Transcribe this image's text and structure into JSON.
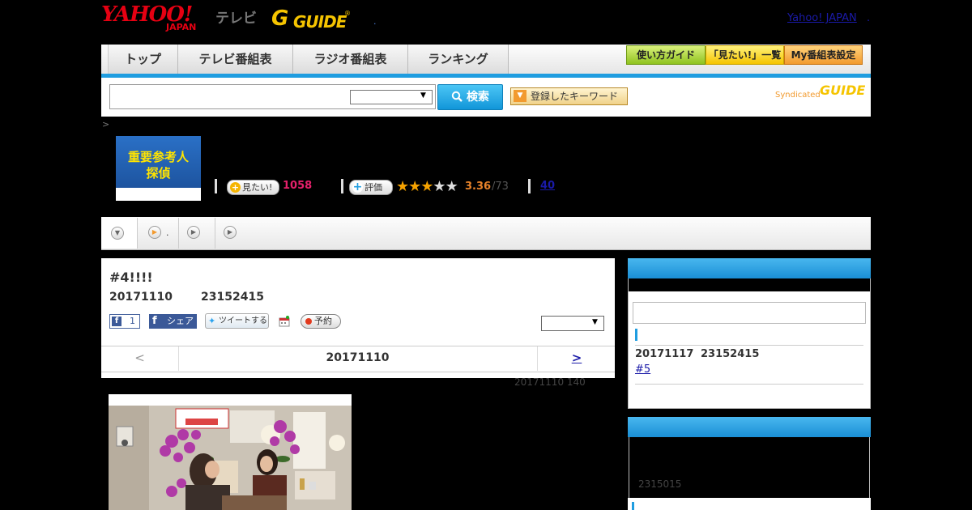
{
  "header": {
    "logo_yahoo": "YAHOO!",
    "logo_japan": "JAPAN",
    "logo_tv": "テレビ",
    "logo_gguide": "GUIDE",
    "logo_g": "G",
    "registered": "®",
    "dot": ".",
    "yahoo_japan_link": "Yahoo! JAPAN",
    "yj_dot": "."
  },
  "nav": {
    "tabs": [
      {
        "label": "トップ"
      },
      {
        "label": "テレビ番組表"
      },
      {
        "label": "ラジオ番組表"
      },
      {
        "label": "ランキング"
      }
    ],
    "buttons": [
      {
        "label": "使い方ガイド"
      },
      {
        "label": "「見たい!」一覧"
      },
      {
        "label": "My番組表設定"
      }
    ]
  },
  "search": {
    "input_value": "",
    "select_value": "",
    "button_label": "検索",
    "button_icon": "magnifier-icon",
    "keyword_button_label": "登録したキーワード",
    "syndicated_label": "Syndicated",
    "syndicated_logo": "GUIDE"
  },
  "breadcrumb": ">",
  "program": {
    "thumbnail_text": [
      "重要参考人",
      "探偵"
    ],
    "want_label": "見たい!",
    "want_count": "1058",
    "rating_label": "評価",
    "rating_stars_filled": 3,
    "rating_stars_total": 5,
    "rating_score": "3.36",
    "rating_total": "/73",
    "reviews_count": "40"
  },
  "subnav": {
    "tab_dot": "."
  },
  "episode": {
    "title": "#4!!!!",
    "date": "20171110",
    "time": "23152415",
    "fb_like_count": "1",
    "fb_share_label": "シェア",
    "tweet_label": "ツイートする",
    "reserve_label": "予約",
    "select_value": "",
    "pager_prev": "<",
    "pager_date": "20171110",
    "pager_next": ">",
    "update_note": "20171110  140"
  },
  "sidebar": {
    "next_date": "20171117",
    "next_time": "23152415",
    "next_episode": "#5",
    "code": "2315015"
  },
  "colors": {
    "accent_blue": "#1f9de0",
    "brand_red": "#e60012",
    "gguide_yellow": "#f5c400",
    "want_pink": "#e6206b",
    "score_orange": "#e8832a",
    "link_blue": "#1a1aa8"
  }
}
